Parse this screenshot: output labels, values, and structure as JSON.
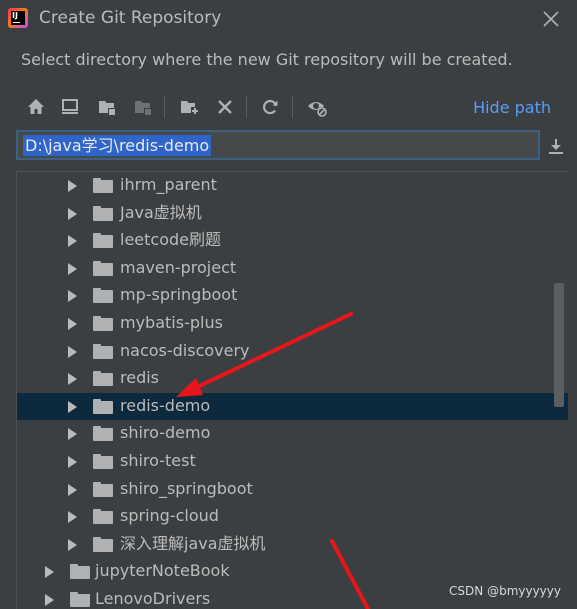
{
  "window": {
    "title": "Create Git Repository",
    "app_icon_text": "IJ"
  },
  "description": "Select directory where the new Git repository will be created.",
  "toolbar": {
    "buttons": [
      "home-icon",
      "desktop-icon",
      "project-folder-icon",
      "module-folder-icon",
      "new-folder-icon",
      "delete-icon",
      "refresh-icon",
      "show-hidden-icon"
    ],
    "hide_path_label": "Hide path"
  },
  "path_field": {
    "value": "D:\\java学习\\redis-demo"
  },
  "tree": {
    "items": [
      {
        "label": "ihrm_parent",
        "level": 2
      },
      {
        "label": "Java虚拟机",
        "level": 2
      },
      {
        "label": "leetcode刷题",
        "level": 2
      },
      {
        "label": "maven-project",
        "level": 2
      },
      {
        "label": "mp-springboot",
        "level": 2
      },
      {
        "label": "mybatis-plus",
        "level": 2
      },
      {
        "label": "nacos-discovery",
        "level": 2
      },
      {
        "label": "redis",
        "level": 2
      },
      {
        "label": "redis-demo",
        "level": 2,
        "selected": true
      },
      {
        "label": "shiro-demo",
        "level": 2
      },
      {
        "label": "shiro-test",
        "level": 2
      },
      {
        "label": "shiro_springboot",
        "level": 2
      },
      {
        "label": "spring-cloud",
        "level": 2
      },
      {
        "label": "深入理解java虚拟机",
        "level": 2
      },
      {
        "label": "jupyterNoteBook",
        "level": 1
      },
      {
        "label": "LenovoDrivers",
        "level": 1
      }
    ]
  },
  "watermark": "CSDN @bmyyyyyy",
  "colors": {
    "background": "#3c3f41",
    "selection": "#0d293e",
    "link": "#589df6",
    "annotation_arrow": "#e8161a"
  }
}
